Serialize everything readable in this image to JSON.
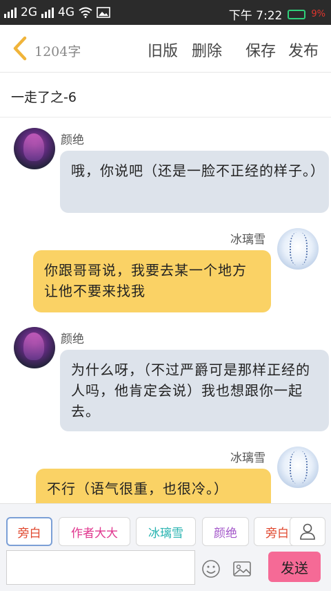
{
  "status_bar": {
    "network_1": "2G",
    "network_2": "4G",
    "time": "下午 7:22",
    "battery": "9%"
  },
  "toolbar": {
    "word_count": "1204字",
    "old_version": "旧版",
    "delete": "删除",
    "save": "保存",
    "publish": "发布"
  },
  "chapter_title": "一走了之-6",
  "messages": [
    {
      "speaker": "颜绝",
      "side": "left",
      "text": "哦，你说吧（还是一脸不正经的样子。）"
    },
    {
      "speaker": "冰璃雪",
      "side": "right",
      "text": "你跟哥哥说，我要去某一个地方让他不要来找我"
    },
    {
      "speaker": "颜绝",
      "side": "left",
      "text": "为什么呀，（不过严爵可是那样正经的人吗，他肯定会说）我也想跟你一起去。"
    },
    {
      "speaker": "冰璃雪",
      "side": "right",
      "text": "不行（语气很重，也很冷。）"
    }
  ],
  "roles": [
    {
      "label": "旁白",
      "color": "#e0472e"
    },
    {
      "label": "作者大大",
      "color": "#e0368e"
    },
    {
      "label": "冰璃雪",
      "color": "#27b3b0"
    },
    {
      "label": "颜绝",
      "color": "#a356c9"
    },
    {
      "label": "旁白",
      "color": "#e0472e"
    }
  ],
  "input": {
    "placeholder": ""
  },
  "send_label": "发送",
  "icons": [
    "back-chevron-icon",
    "emoji-icon",
    "image-icon",
    "person-icon"
  ]
}
